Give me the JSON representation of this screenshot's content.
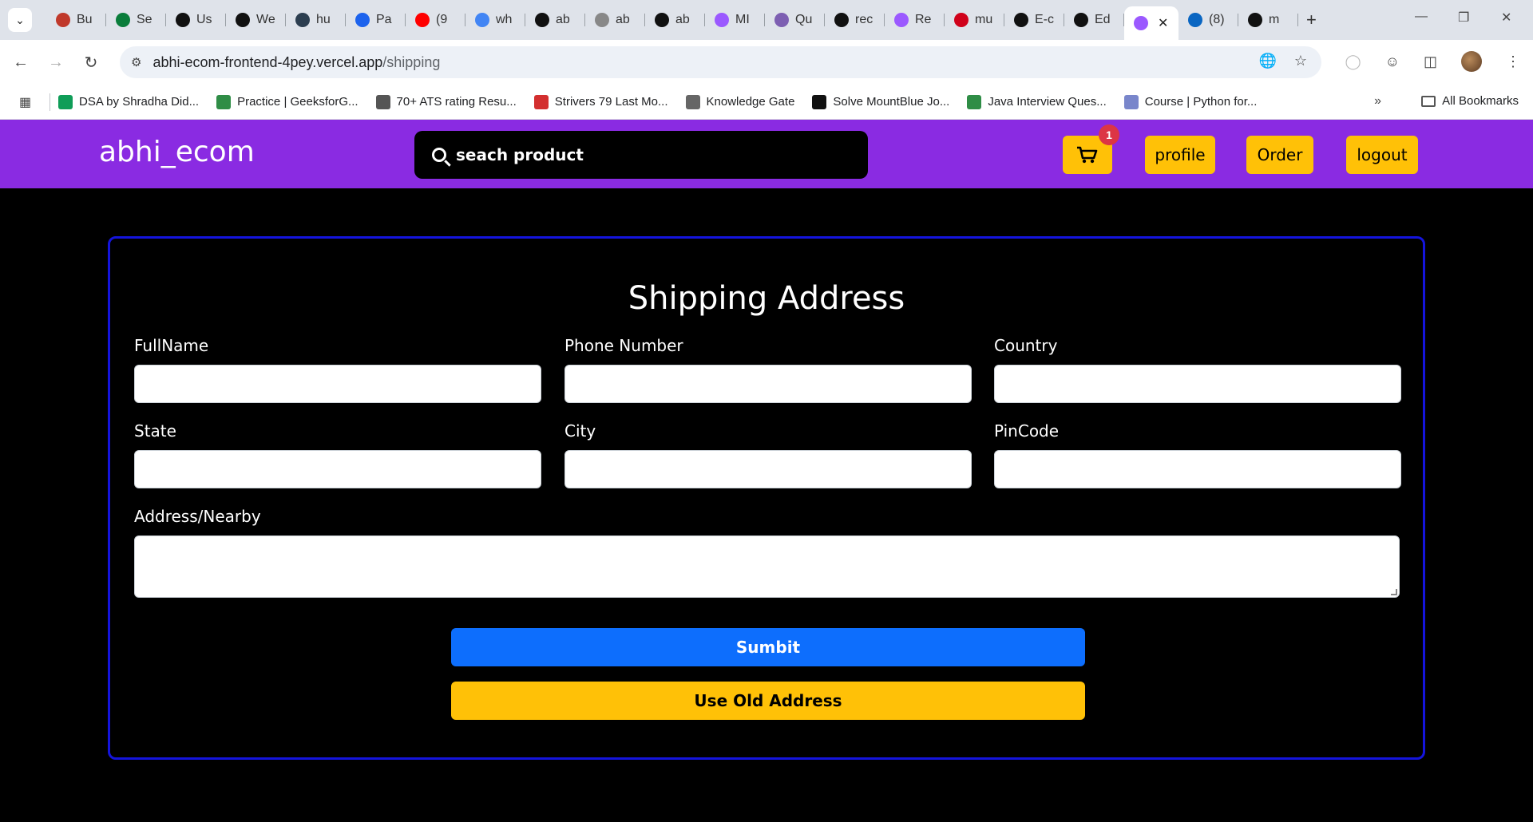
{
  "browser": {
    "tabs": [
      {
        "label": "Bu",
        "icon": "avatar-icon",
        "color": "#c0392b"
      },
      {
        "label": "Se",
        "icon": "leaf-icon",
        "color": "#0a7d3b"
      },
      {
        "label": "Us",
        "icon": "openai-icon",
        "color": "#111111"
      },
      {
        "label": "We",
        "icon": "github-icon",
        "color": "#111111"
      },
      {
        "label": "hu",
        "icon": "globe-icon",
        "color": "#2c3e50"
      },
      {
        "label": "Pa",
        "icon": "docker-icon",
        "color": "#1d63ed"
      },
      {
        "label": "(9",
        "icon": "youtube-icon",
        "color": "#ff0000"
      },
      {
        "label": "wh",
        "icon": "google-icon",
        "color": "#4285f4"
      },
      {
        "label": "ab",
        "icon": "vercel-link-icon",
        "color": "#111111"
      },
      {
        "label": "ab",
        "icon": "globe-icon",
        "color": "#888888"
      },
      {
        "label": "ab",
        "icon": "triangle-icon",
        "color": "#111111"
      },
      {
        "label": "MI",
        "icon": "vite-icon",
        "color": "#9b59ff"
      },
      {
        "label": "Qu",
        "icon": "knot-icon",
        "color": "#7d5fb2"
      },
      {
        "label": "rec",
        "icon": "github-icon",
        "color": "#111111"
      },
      {
        "label": "Re",
        "icon": "vite-icon",
        "color": "#9b59ff"
      },
      {
        "label": "mu",
        "icon": "bookmark-icon",
        "color": "#d0021b"
      },
      {
        "label": "E-c",
        "icon": "openai-icon",
        "color": "#111111"
      },
      {
        "label": "Ed",
        "icon": "github-icon",
        "color": "#111111"
      }
    ],
    "active_tab": {
      "label": "",
      "icon": "vite-icon",
      "color": "#9b59ff"
    },
    "tabs_after": [
      {
        "label": "(8)",
        "icon": "linkedin-icon",
        "color": "#0a66c2"
      },
      {
        "label": "m",
        "icon": "github-icon",
        "color": "#111111"
      }
    ],
    "url_host": "abhi-ecom-frontend-4pey.vercel.app",
    "url_path": "/shipping",
    "bookmarks": [
      {
        "label": "DSA by Shradha Did...",
        "icon": "sheets-icon",
        "color": "#0f9d58"
      },
      {
        "label": "Practice | GeeksforG...",
        "icon": "gfg-icon",
        "color": "#2f8d46"
      },
      {
        "label": "70+ ATS rating Resu...",
        "icon": "leaf-icon",
        "color": "#555555"
      },
      {
        "label": "Strivers 79 Last Mo...",
        "icon": "tuf-icon",
        "color": "#d32f2f"
      },
      {
        "label": "Knowledge Gate",
        "icon": "kg-icon",
        "color": "#666666"
      },
      {
        "label": "Solve MountBlue Jo...",
        "icon": "hackerearth-icon",
        "color": "#111111"
      },
      {
        "label": "Java Interview Ques...",
        "icon": "gfg-icon",
        "color": "#2f8d46"
      },
      {
        "label": "Course | Python for...",
        "icon": "course-icon",
        "color": "#7986cb"
      }
    ],
    "all_bookmarks": "All Bookmarks"
  },
  "nav": {
    "brand": "abhi_ecom",
    "search_placeholder": "seach product",
    "cart_count": "1",
    "profile": "profile",
    "order": "Order",
    "logout": "logout",
    "accent": "#8a2be2",
    "button_color": "#ffc107"
  },
  "form": {
    "title": "Shipping Address",
    "labels": {
      "fullname": "FullName",
      "phone": "Phone Number",
      "country": "Country",
      "state": "State",
      "city": "City",
      "pincode": "PinCode",
      "address": "Address/Nearby"
    },
    "values": {
      "fullname": "",
      "phone": "",
      "country": "",
      "state": "",
      "city": "",
      "pincode": "",
      "address": ""
    },
    "submit": "Sumbit",
    "use_old": "Use Old Address",
    "border_color": "#1414dc"
  }
}
